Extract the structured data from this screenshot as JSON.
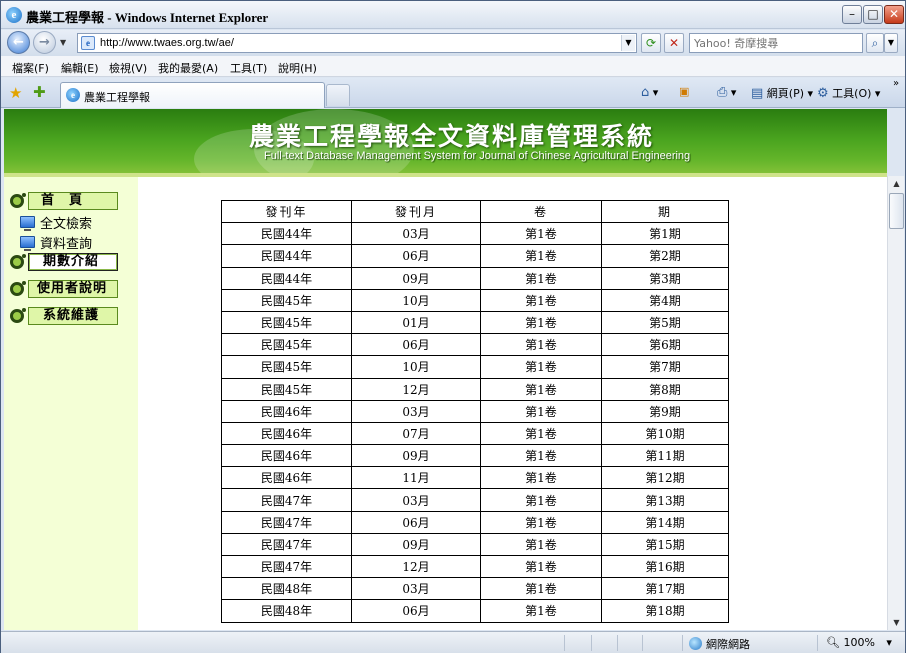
{
  "window": {
    "title": "農業工程學報 - Windows Internet Explorer",
    "logo_glyph": "e"
  },
  "address_bar": {
    "url": "http://www.twaes.org.tw/ae/",
    "search_placeholder": "Yahoo! 奇摩搜尋"
  },
  "menu": [
    "檔案(F)",
    "編輯(E)",
    "檢視(V)",
    "我的最愛(A)",
    "工具(T)",
    "說明(H)"
  ],
  "tab": {
    "label": "農業工程學報"
  },
  "command_bar": {
    "page_label": "網頁(P)",
    "tools_label": "工具(O)"
  },
  "banner": {
    "title": "農業工程學報全文資料庫管理系統",
    "subtitle": "Full-text Database Management System for Journal of Chinese Agricultural Engineering",
    "color": "#4aa41f"
  },
  "sidebar": {
    "home": "首　頁",
    "fulltext_search": "全文檢索",
    "data_query": "資料查詢",
    "issues_intro": "期數介紹",
    "user_guide": "使用者說明",
    "system_maintenance": "系統維護"
  },
  "table": {
    "headers": [
      "發刊年",
      "發刊月",
      "卷",
      "期"
    ],
    "rows": [
      [
        "民國44年",
        "03月",
        "第1卷",
        "第1期"
      ],
      [
        "民國44年",
        "06月",
        "第1卷",
        "第2期"
      ],
      [
        "民國44年",
        "09月",
        "第1卷",
        "第3期"
      ],
      [
        "民國45年",
        "10月",
        "第1卷",
        "第4期"
      ],
      [
        "民國45年",
        "01月",
        "第1卷",
        "第5期"
      ],
      [
        "民國45年",
        "06月",
        "第1卷",
        "第6期"
      ],
      [
        "民國45年",
        "10月",
        "第1卷",
        "第7期"
      ],
      [
        "民國45年",
        "12月",
        "第1卷",
        "第8期"
      ],
      [
        "民國46年",
        "03月",
        "第1卷",
        "第9期"
      ],
      [
        "民國46年",
        "07月",
        "第1卷",
        "第10期"
      ],
      [
        "民國46年",
        "09月",
        "第1卷",
        "第11期"
      ],
      [
        "民國46年",
        "11月",
        "第1卷",
        "第12期"
      ],
      [
        "民國47年",
        "03月",
        "第1卷",
        "第13期"
      ],
      [
        "民國47年",
        "06月",
        "第1卷",
        "第14期"
      ],
      [
        "民國47年",
        "09月",
        "第1卷",
        "第15期"
      ],
      [
        "民國47年",
        "12月",
        "第1卷",
        "第16期"
      ],
      [
        "民國48年",
        "03月",
        "第1卷",
        "第17期"
      ],
      [
        "民國48年",
        "06月",
        "第1卷",
        "第18期"
      ]
    ]
  },
  "status_bar": {
    "zone": "網際網路",
    "zoom": "100%"
  }
}
